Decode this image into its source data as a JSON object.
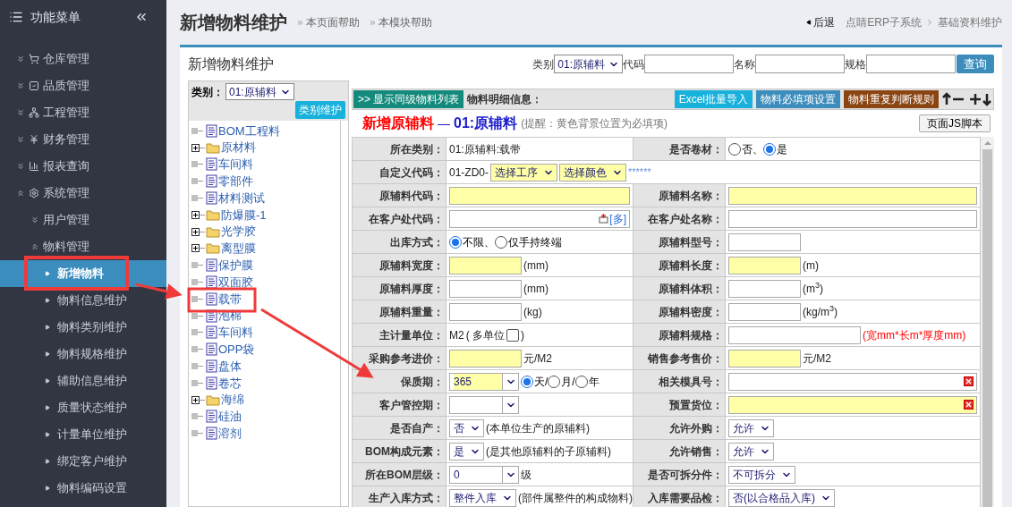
{
  "sidebar": {
    "title": "功能菜单",
    "items": [
      {
        "label": "仓库管理",
        "expanded": false
      },
      {
        "label": "品质管理",
        "expanded": false
      },
      {
        "label": "工程管理",
        "expanded": false
      },
      {
        "label": "财务管理",
        "expanded": false
      },
      {
        "label": "报表查询",
        "expanded": false
      },
      {
        "label": "系统管理",
        "expanded": true,
        "children": [
          {
            "label": "用户管理",
            "expanded": false
          },
          {
            "label": "物料管理",
            "expanded": true,
            "children": [
              {
                "label": "新增物料",
                "selected": true
              },
              {
                "label": "物料信息维护",
                "selected": false
              },
              {
                "label": "物料类别维护",
                "selected": false
              },
              {
                "label": "物料规格维护",
                "selected": false
              },
              {
                "label": "辅助信息维护",
                "selected": false
              },
              {
                "label": "质量状态维护",
                "selected": false
              },
              {
                "label": "计量单位维护",
                "selected": false
              },
              {
                "label": "绑定客户维护",
                "selected": false
              },
              {
                "label": "物料编码设置",
                "selected": false
              }
            ]
          }
        ]
      }
    ]
  },
  "page": {
    "title": "新增物料维护",
    "help_links": [
      "本页面帮助",
      "本模块帮助"
    ],
    "back": "后退",
    "breadcrumb": [
      "点睛ERP子系统",
      "基础资料维护"
    ]
  },
  "panel": {
    "title": "新增物料维护",
    "search": [
      {
        "kind": "select",
        "label": "类别",
        "value": "01:原辅料"
      },
      {
        "kind": "input",
        "label": "代码"
      },
      {
        "kind": "input",
        "label": "名称"
      },
      {
        "kind": "input",
        "label": "规格"
      }
    ],
    "search_button": "查询"
  },
  "tree": {
    "category_label": "类别：",
    "category_value": "01:原辅料",
    "maintain_button": "类别维护",
    "nodes": [
      {
        "label": "BOM工程料",
        "kind": "doc"
      },
      {
        "label": "原材料",
        "kind": "folder"
      },
      {
        "label": "车间料",
        "kind": "doc"
      },
      {
        "label": "零部件",
        "kind": "doc"
      },
      {
        "label": "材料测试",
        "kind": "doc"
      },
      {
        "label": "防爆膜-1",
        "kind": "folder"
      },
      {
        "label": "光学胶",
        "kind": "folder"
      },
      {
        "label": "离型膜",
        "kind": "folder"
      },
      {
        "label": "保护膜",
        "kind": "doc"
      },
      {
        "label": "双面胶",
        "kind": "doc"
      },
      {
        "label": "载带",
        "kind": "doc"
      },
      {
        "label": "泡棉",
        "kind": "doc"
      },
      {
        "label": "车间料",
        "kind": "doc"
      },
      {
        "label": "OPP袋",
        "kind": "doc"
      },
      {
        "label": "盘体",
        "kind": "doc"
      },
      {
        "label": "卷芯",
        "kind": "doc"
      },
      {
        "label": "海绵",
        "kind": "folder"
      },
      {
        "label": "硅油",
        "kind": "doc"
      },
      {
        "label": "溶剂",
        "kind": "doc"
      }
    ]
  },
  "toolbar": {
    "list_button": ">> 显示同级物料列表",
    "label": "物料明细信息：",
    "buttons": [
      {
        "label": "Excel批量导入",
        "color": "#17b1dc"
      },
      {
        "label": "物料必填项设置",
        "color": "#3c8dbc"
      },
      {
        "label": "物料重复判断规则",
        "color": "#8b4513"
      }
    ]
  },
  "form": {
    "title": "新增原辅料",
    "separator": "—",
    "category": "01:原辅料",
    "reminder": "(提醒：黄色背景位置为必填项)",
    "script_button": "页面JS脚本",
    "rows": [
      {
        "cells": [
          {
            "label": "所在类别：",
            "fields": [
              {
                "kind": "text",
                "text": "01:原辅料:载带"
              }
            ]
          },
          {
            "label": "是否卷材：",
            "fields": [
              {
                "kind": "radio",
                "options": [
                  {
                    "label": "否、",
                    "selected": false
                  },
                  {
                    "label": "是",
                    "selected": true
                  }
                ]
              }
            ]
          }
        ]
      },
      {
        "cells": [
          {
            "label": "自定义代码：",
            "fields": [
              {
                "kind": "text",
                "text": "01-ZD0-"
              },
              {
                "kind": "select",
                "value": "选择工序",
                "required": true
              },
              {
                "kind": "select",
                "value": "选择颜色",
                "required": true
              },
              {
                "kind": "mask",
                "text": "******"
              }
            ]
          }
        ]
      },
      {
        "cells": [
          {
            "label": "原辅料代码：",
            "fields": [
              {
                "kind": "wide_input",
                "required": true
              }
            ]
          },
          {
            "label": "原辅料名称：",
            "fields": [
              {
                "kind": "wide_input",
                "required": true
              }
            ]
          }
        ]
      },
      {
        "cells": [
          {
            "label": "在客户处代码：",
            "fields": [
              {
                "kind": "wide_input",
                "required": false,
                "link": "[多]"
              }
            ]
          },
          {
            "label": "在客户处名称：",
            "fields": [
              {
                "kind": "wide_input",
                "required": false
              }
            ]
          }
        ]
      },
      {
        "cells": [
          {
            "label": "出库方式：",
            "fields": [
              {
                "kind": "radio",
                "options": [
                  {
                    "label": "不限、",
                    "selected": true
                  },
                  {
                    "label": "仅手持终端",
                    "selected": false
                  }
                ]
              }
            ]
          },
          {
            "label": "原辅料型号：",
            "fields": [
              {
                "kind": "input",
                "required": false
              }
            ]
          }
        ]
      },
      {
        "cells": [
          {
            "label": "原辅料宽度：",
            "fields": [
              {
                "kind": "input",
                "required": true
              },
              {
                "kind": "text",
                "text": "(mm)"
              }
            ]
          },
          {
            "label": "原辅料长度：",
            "fields": [
              {
                "kind": "input",
                "required": true
              },
              {
                "kind": "text",
                "text": "(m)"
              }
            ]
          }
        ]
      },
      {
        "cells": [
          {
            "label": "原辅料厚度：",
            "fields": [
              {
                "kind": "input",
                "required": false
              },
              {
                "kind": "text",
                "text": "(mm)"
              }
            ]
          },
          {
            "label": "原辅料体积：",
            "fields": [
              {
                "kind": "input",
                "required": false
              },
              {
                "kind": "text",
                "text": "(m$^{3}$)"
              }
            ]
          }
        ]
      },
      {
        "cells": [
          {
            "label": "原辅料重量：",
            "fields": [
              {
                "kind": "input",
                "required": false
              },
              {
                "kind": "text",
                "text": "(kg)"
              }
            ]
          },
          {
            "label": "原辅料密度：",
            "fields": [
              {
                "kind": "input",
                "required": false
              },
              {
                "kind": "text",
                "text": "(kg/m$^{3}$)"
              }
            ]
          }
        ]
      },
      {
        "cells": [
          {
            "label": "主计量单位：",
            "fields": [
              {
                "kind": "text",
                "text": "M2"
              },
              {
                "kind": "text",
                "text": "( 多单位"
              },
              {
                "kind": "checkbox",
                "checked": false
              },
              {
                "kind": "text",
                "text": ")"
              }
            ]
          },
          {
            "label": "原辅料规格：",
            "fields": [
              {
                "kind": "medium_input",
                "required": false
              },
              {
                "kind": "warning",
                "text": "(宽mm*长m*厚度mm)"
              }
            ]
          }
        ]
      },
      {
        "cells": [
          {
            "label": "采购参考进价：",
            "fields": [
              {
                "kind": "input",
                "required": true
              },
              {
                "kind": "text",
                "text": "元/M2"
              }
            ]
          },
          {
            "label": "销售参考售价：",
            "fields": [
              {
                "kind": "input",
                "required": true
              },
              {
                "kind": "text",
                "text": "元/M2"
              }
            ]
          }
        ]
      },
      {
        "cells": [
          {
            "label": "保质期：",
            "fields": [
              {
                "kind": "combo",
                "value": "365",
                "required": true
              },
              {
                "kind": "radio",
                "options": [
                  {
                    "label": "天/",
                    "selected": true
                  },
                  {
                    "label": "月/",
                    "selected": false
                  },
                  {
                    "label": "年",
                    "selected": false
                  }
                ]
              }
            ]
          },
          {
            "label": "相关模具号：",
            "fields": [
              {
                "kind": "wide_input",
                "required": false,
                "clearable": true
              }
            ]
          }
        ]
      },
      {
        "cells": [
          {
            "label": "客户管控期：",
            "fields": [
              {
                "kind": "combo",
                "required": false
              }
            ]
          },
          {
            "label": "预置货位：",
            "fields": [
              {
                "kind": "wide_input",
                "required": true,
                "clearable": true
              }
            ]
          }
        ]
      },
      {
        "cells": [
          {
            "label": "是否自产：",
            "fields": [
              {
                "kind": "select",
                "value": "否",
                "required": false
              },
              {
                "kind": "text",
                "text": "(本单位生产的原辅料)"
              }
            ]
          },
          {
            "label": "允许外购：",
            "fields": [
              {
                "kind": "select",
                "value": "允许",
                "required": false
              }
            ]
          }
        ]
      },
      {
        "cells": [
          {
            "label": "BOM构成元素：",
            "fields": [
              {
                "kind": "select",
                "value": "是",
                "required": false
              },
              {
                "kind": "text",
                "text": "(是其他原辅料的子原辅料)"
              }
            ]
          },
          {
            "label": "允许销售：",
            "fields": [
              {
                "kind": "select",
                "value": "允许",
                "required": false
              }
            ]
          }
        ]
      },
      {
        "cells": [
          {
            "label": "所在BOM层级：",
            "fields": [
              {
                "kind": "combo",
                "value": "0",
                "required": false
              },
              {
                "kind": "text",
                "text": "级"
              }
            ]
          },
          {
            "label": "是否可拆分件：",
            "fields": [
              {
                "kind": "select",
                "value": "不可拆分",
                "required": false
              }
            ]
          }
        ]
      },
      {
        "cells": [
          {
            "label": "生产入库方式：",
            "fields": [
              {
                "kind": "select",
                "value": "整件入库",
                "required": false
              },
              {
                "kind": "text",
                "text": "(部件属整件的构成物料)"
              }
            ]
          },
          {
            "label": "入库需要品检：",
            "fields": [
              {
                "kind": "select",
                "value": "否(以合格品入库)",
                "required": false
              }
            ]
          }
        ]
      }
    ]
  }
}
